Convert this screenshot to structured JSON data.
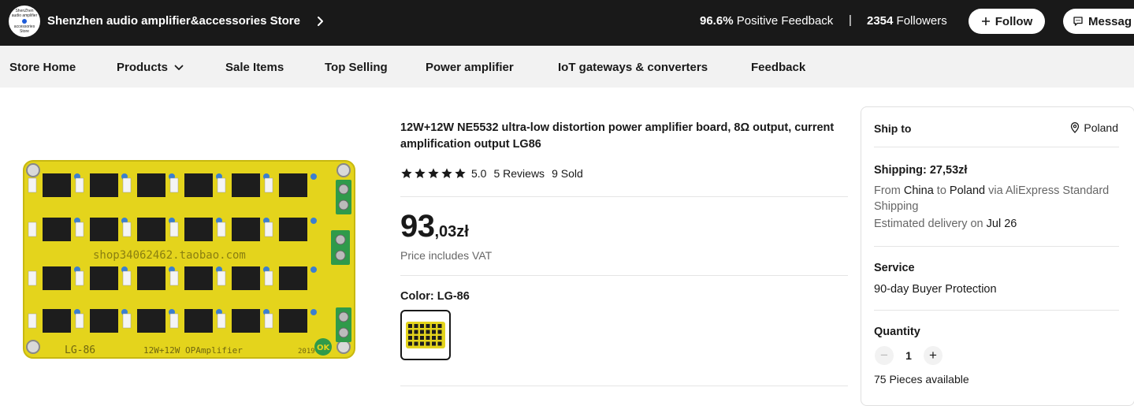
{
  "store": {
    "logo_lines": [
      "ShenZhen",
      "audio amplifier",
      "accessories",
      "Store"
    ],
    "name": "Shenzhen audio amplifier&accessories Store",
    "positive_feedback_value": "96.6%",
    "positive_feedback_label": "Positive Feedback",
    "separator": "|",
    "followers_count": "2354",
    "followers_label": "Followers",
    "follow_label": "Follow",
    "message_label": "Messag"
  },
  "nav": {
    "items": [
      "Store Home",
      "Products",
      "Sale Items",
      "Top Selling",
      "Power amplifier",
      "IoT gateways & converters",
      "Feedback"
    ]
  },
  "product": {
    "image_board_text": {
      "watermark": "shop34062462.taobao.com",
      "model": "LG-86",
      "label": "12W+12W OPAmplifier",
      "year": "2019",
      "ok": "OK"
    },
    "title": "12W+12W NE5532 ultra-low distortion power amplifier board, 8Ω output, current amplification output LG86",
    "rating": 5,
    "rating_score": "5.0",
    "reviews": "5 Reviews",
    "sold": "9 Sold",
    "price_int": "93",
    "price_dec": ",03zł",
    "vat_note": "Price includes VAT",
    "color_label": "Color: LG-86"
  },
  "shipping": {
    "ship_to_label": "Ship to",
    "ship_to_country": "Poland",
    "shipping_title": "Shipping: 27,53zł",
    "from_word": "From",
    "from_country": "China",
    "to_word": "to",
    "to_country": "Poland",
    "via_text": "via AliExpress Standard Shipping",
    "delivery_prefix": "Estimated delivery on",
    "delivery_date": "Jul 26",
    "service_title": "Service",
    "service_value": "90-day Buyer Protection",
    "quantity_title": "Quantity",
    "quantity_value": "1",
    "available": "75 Pieces available"
  },
  "colors": {
    "topbar": "#191919",
    "navbar": "#f2f2f2",
    "board": "#e8d81a",
    "terminal": "#2f9a4a"
  }
}
